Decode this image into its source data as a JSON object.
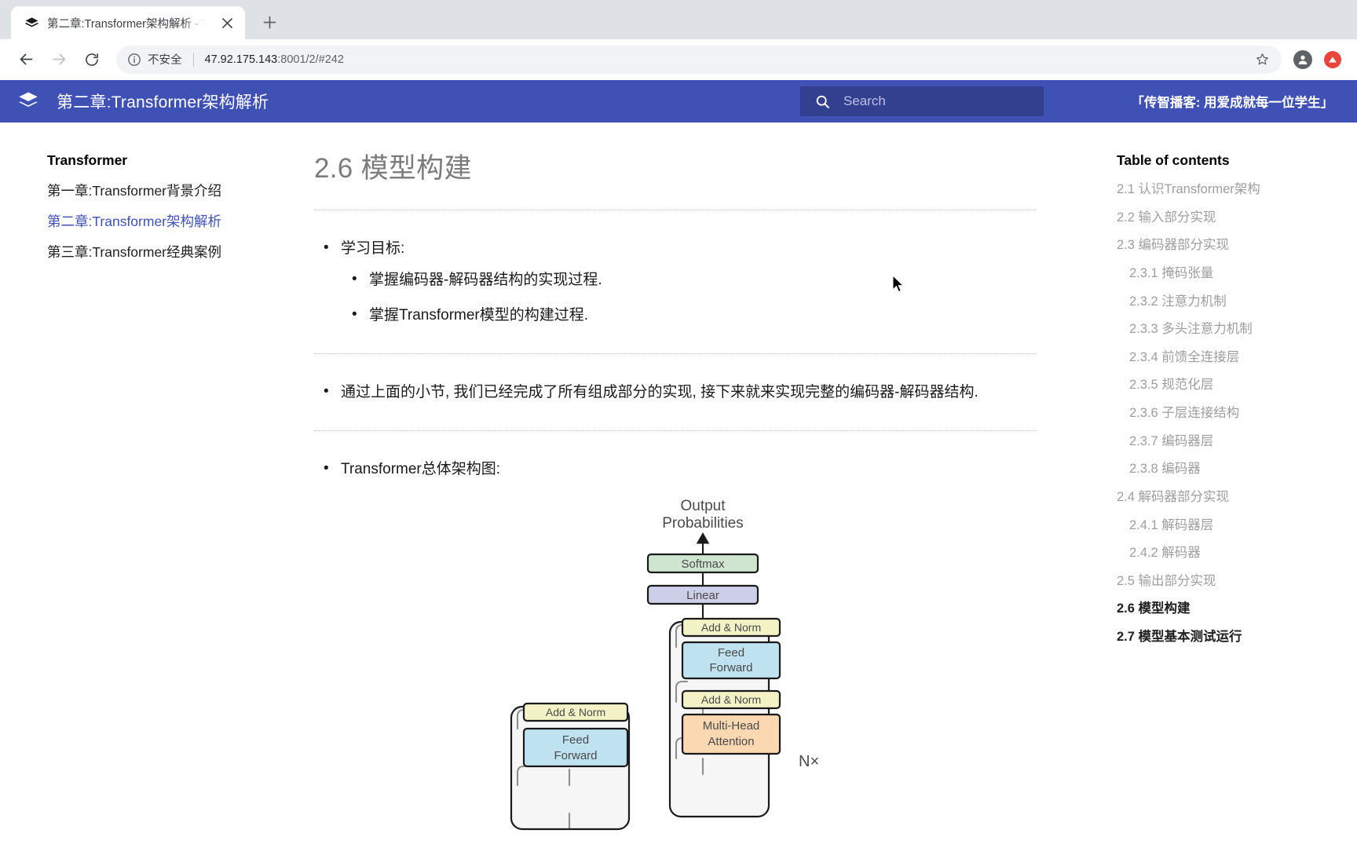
{
  "browser": {
    "tab": {
      "title": "第二章:Transformer架构解析 - T",
      "favicon_icon": "book-stack-icon",
      "close_icon": "close-icon"
    },
    "new_tab_label": "+",
    "nav": {
      "back_icon": "arrow-left-icon",
      "forward_icon": "arrow-right-icon",
      "reload_icon": "reload-icon"
    },
    "omnibox": {
      "info_icon": "info-circle-icon",
      "security_label": "不安全",
      "url_host": "47.92.175.143",
      "url_path": ":8001/2/#242",
      "bookmark_icon": "star-icon",
      "profile_icon": "profile-avatar-icon",
      "extension_icon": "extension-red-icon"
    }
  },
  "site_header": {
    "logo_icon": "mkdocs-book-icon",
    "title": "第二章:Transformer架构解析",
    "search": {
      "icon": "search-icon",
      "placeholder": "Search",
      "value": ""
    },
    "slogan": "「传智播客: 用爱成就每一位学生」",
    "bg_color": "#3f51b5",
    "search_bg_color": "#32408f"
  },
  "sidebar": {
    "heading": "Transformer",
    "items": [
      {
        "label": "第一章:Transformer背景介绍",
        "active": false
      },
      {
        "label": "第二章:Transformer架构解析",
        "active": true
      },
      {
        "label": "第三章:Transformer经典案例",
        "active": false
      }
    ],
    "active_color": "#3f51b5"
  },
  "main": {
    "title": "2.6 模型构建",
    "sections": [
      {
        "bullet": "学习目标:",
        "sub_bullets": [
          "掌握编码器-解码器结构的实现过程.",
          "掌握Transformer模型的构建过程."
        ]
      },
      {
        "bullet": "通过上面的小节, 我们已经完成了所有组成部分的实现, 接下来就来实现完整的编码器-解码器结构.",
        "sub_bullets": []
      },
      {
        "bullet": "Transformer总体架构图:",
        "sub_bullets": []
      }
    ]
  },
  "diagram": {
    "caption_top": [
      "Output",
      "Probabilities"
    ],
    "nx_label": "N×",
    "boxes": [
      {
        "label": "Softmax",
        "color": "#cfe5cf"
      },
      {
        "label": "Linear",
        "color": "#cdcfe8"
      },
      {
        "label": "Add & Norm",
        "color": "#f2f2c6"
      },
      {
        "label": "Feed Forward",
        "color": "#bfe2f0"
      },
      {
        "label": "Add & Norm",
        "color": "#f2f2c6"
      },
      {
        "label": "Multi-Head Attention",
        "color": "#fbd8b2"
      },
      {
        "label": "Add & Norm",
        "color": "#f2f2c6"
      },
      {
        "label": "Feed Forward",
        "color": "#bfe2f0"
      }
    ]
  },
  "toc": {
    "title": "Table of contents",
    "items": [
      {
        "label": "2.1 认识Transformer架构",
        "level": 2,
        "current": false
      },
      {
        "label": "2.2 输入部分实现",
        "level": 2,
        "current": false
      },
      {
        "label": "2.3 编码器部分实现",
        "level": 2,
        "current": false
      },
      {
        "label": "2.3.1 掩码张量",
        "level": 3,
        "current": false
      },
      {
        "label": "2.3.2 注意力机制",
        "level": 3,
        "current": false
      },
      {
        "label": "2.3.3 多头注意力机制",
        "level": 3,
        "current": false
      },
      {
        "label": "2.3.4 前馈全连接层",
        "level": 3,
        "current": false
      },
      {
        "label": "2.3.5 规范化层",
        "level": 3,
        "current": false
      },
      {
        "label": "2.3.6 子层连接结构",
        "level": 3,
        "current": false
      },
      {
        "label": "2.3.7 编码器层",
        "level": 3,
        "current": false
      },
      {
        "label": "2.3.8 编码器",
        "level": 3,
        "current": false
      },
      {
        "label": "2.4 解码器部分实现",
        "level": 2,
        "current": false
      },
      {
        "label": "2.4.1 解码器层",
        "level": 3,
        "current": false
      },
      {
        "label": "2.4.2 解码器",
        "level": 3,
        "current": false
      },
      {
        "label": "2.5 输出部分实现",
        "level": 2,
        "current": false
      },
      {
        "label": "2.6 模型构建",
        "level": 2,
        "current": true
      },
      {
        "label": "2.7 模型基本测试运行",
        "level": 2,
        "current": true
      }
    ]
  }
}
